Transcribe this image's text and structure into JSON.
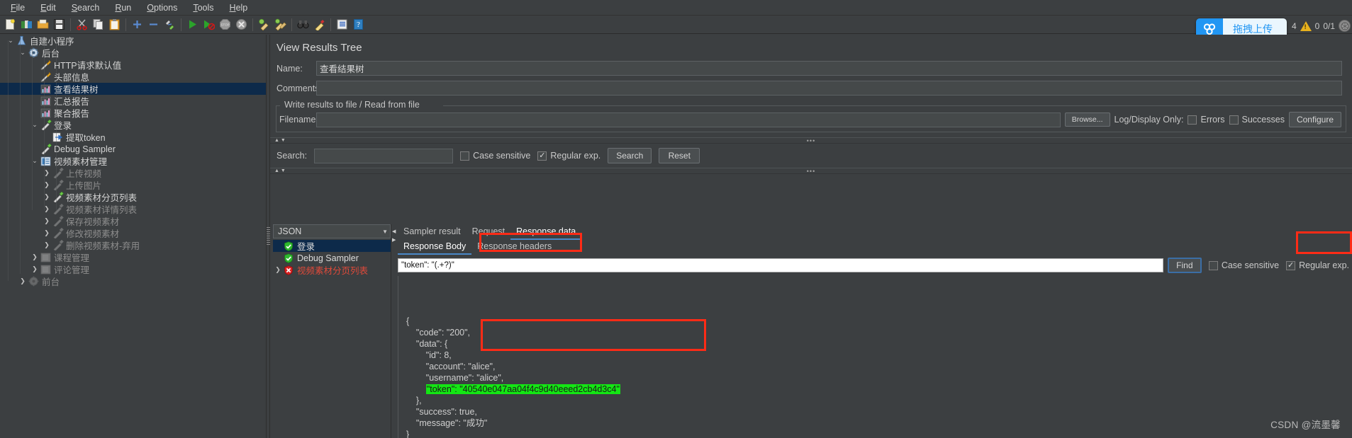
{
  "window": {
    "menubar": [
      {
        "label": "File",
        "mnemonic": "F"
      },
      {
        "label": "Edit",
        "mnemonic": "E"
      },
      {
        "label": "Search",
        "mnemonic": "S"
      },
      {
        "label": "Run",
        "mnemonic": "R"
      },
      {
        "label": "Options",
        "mnemonic": "O"
      },
      {
        "label": "Tools",
        "mnemonic": "T"
      },
      {
        "label": "Help",
        "mnemonic": "H"
      }
    ],
    "toolbar": [
      {
        "name": "new-icon"
      },
      {
        "name": "templates-icon"
      },
      {
        "name": "open-folder-icon"
      },
      {
        "name": "save-icon"
      },
      {
        "sep": true
      },
      {
        "name": "cut-scissors-icon"
      },
      {
        "name": "copy-icon"
      },
      {
        "name": "paste-clipboard-icon"
      },
      {
        "sep": true
      },
      {
        "name": "expand-plus-icon"
      },
      {
        "name": "collapse-minus-icon"
      },
      {
        "name": "toggle-pencil-icon"
      },
      {
        "sep": true
      },
      {
        "name": "start-play-icon"
      },
      {
        "name": "start-no-pauses-icon"
      },
      {
        "name": "stop-icon"
      },
      {
        "name": "shutdown-icon"
      },
      {
        "sep": true
      },
      {
        "name": "clear-broom-icon"
      },
      {
        "name": "clear-all-broom-icon"
      },
      {
        "sep": true
      },
      {
        "name": "search-binoculars-icon"
      },
      {
        "name": "search-reset-broom-icon"
      },
      {
        "sep": true
      },
      {
        "name": "function-helper-icon"
      },
      {
        "name": "help-question-icon"
      }
    ],
    "upload": {
      "icon": "baidu-netdisk-icon",
      "label": "拖拽上传"
    },
    "status": {
      "count": "4",
      "warn_icon": "warning-triangle-icon",
      "warn_count": "0",
      "threads": "0/1",
      "thread_icon": "thread-status-icon"
    }
  },
  "tree": {
    "selected_index": 3,
    "items": [
      {
        "depth": 0,
        "twisty": "v",
        "icon": "test-plan-icon",
        "label": "自建小程序",
        "state": "normal"
      },
      {
        "depth": 1,
        "twisty": "v",
        "icon": "thread-group-icon",
        "label": "后台",
        "state": "normal"
      },
      {
        "depth": 2,
        "twisty": "",
        "icon": "config-element-icon",
        "label": "HTTP请求默认值",
        "state": "normal"
      },
      {
        "depth": 2,
        "twisty": "",
        "icon": "config-element-icon",
        "label": "头部信息",
        "state": "normal"
      },
      {
        "depth": 2,
        "twisty": "",
        "icon": "listener-icon",
        "label": "查看结果树",
        "state": "selected"
      },
      {
        "depth": 2,
        "twisty": "",
        "icon": "listener-icon",
        "label": "汇总报告",
        "state": "normal"
      },
      {
        "depth": 2,
        "twisty": "",
        "icon": "listener-icon",
        "label": "聚合报告",
        "state": "normal"
      },
      {
        "depth": 2,
        "twisty": "v",
        "icon": "sampler-icon",
        "label": "登录",
        "state": "normal"
      },
      {
        "depth": 3,
        "twisty": "",
        "icon": "post-processor-icon",
        "label": "提取token",
        "state": "normal"
      },
      {
        "depth": 2,
        "twisty": "",
        "icon": "sampler-icon",
        "label": "Debug Sampler",
        "state": "normal"
      },
      {
        "depth": 2,
        "twisty": "v",
        "icon": "transaction-controller-icon",
        "label": "视频素材管理",
        "state": "normal"
      },
      {
        "depth": 3,
        "twisty": ">",
        "icon": "sampler-disabled-icon",
        "label": "上传视频",
        "state": "disabled"
      },
      {
        "depth": 3,
        "twisty": ">",
        "icon": "sampler-disabled-icon",
        "label": "上传图片",
        "state": "disabled"
      },
      {
        "depth": 3,
        "twisty": ">",
        "icon": "sampler-icon",
        "label": "视频素材分页列表",
        "state": "normal"
      },
      {
        "depth": 3,
        "twisty": ">",
        "icon": "sampler-disabled-icon",
        "label": "视频素材详情列表",
        "state": "disabled"
      },
      {
        "depth": 3,
        "twisty": ">",
        "icon": "sampler-disabled-icon",
        "label": "保存视频素材",
        "state": "disabled"
      },
      {
        "depth": 3,
        "twisty": ">",
        "icon": "sampler-disabled-icon",
        "label": "修改视频素材",
        "state": "disabled"
      },
      {
        "depth": 3,
        "twisty": ">",
        "icon": "sampler-disabled-icon",
        "label": "删除视频素材-弃用",
        "state": "disabled"
      },
      {
        "depth": 2,
        "twisty": ">",
        "icon": "controller-disabled-icon",
        "label": "课程管理",
        "state": "disabled"
      },
      {
        "depth": 2,
        "twisty": ">",
        "icon": "controller-disabled-icon",
        "label": "评论管理",
        "state": "disabled"
      },
      {
        "depth": 1,
        "twisty": ">",
        "icon": "thread-group-disabled-icon",
        "label": "前台",
        "state": "disabled"
      }
    ]
  },
  "panel": {
    "title": "View Results Tree",
    "name_label": "Name:",
    "name_value": "查看结果树",
    "comments_label": "Comments:",
    "comments_value": "",
    "comments_placeholder": "",
    "file_group_legend": "Write results to file / Read from file",
    "filename_label": "Filename",
    "filename_value": "",
    "browse_button": "Browse...",
    "log_display_label": "Log/Display Only:",
    "errors_checkbox": {
      "label": "Errors",
      "checked": false
    },
    "successes_checkbox": {
      "label": "Successes",
      "checked": false
    },
    "configure_button": "Configure"
  },
  "search_bar": {
    "label": "Search:",
    "value": "",
    "case_sensitive": {
      "label": "Case sensitive",
      "checked": false
    },
    "regular_exp": {
      "label": "Regular exp.",
      "checked": true
    },
    "search_button": "Search",
    "reset_button": "Reset"
  },
  "results": {
    "renderer_combo": "JSON",
    "renderer_options": [
      "JSON"
    ],
    "items": [
      {
        "label": "登录",
        "status": "success",
        "twisty": "",
        "icon": "success-shield-icon",
        "selected": true
      },
      {
        "label": "Debug Sampler",
        "status": "success",
        "twisty": "",
        "icon": "success-shield-icon",
        "selected": false
      },
      {
        "label": "视频素材分页列表",
        "status": "error",
        "twisty": ">",
        "icon": "error-shield-icon",
        "selected": false
      }
    ]
  },
  "detail": {
    "tabs": [
      {
        "label": "Sampler result",
        "active": false
      },
      {
        "label": "Request",
        "active": false
      },
      {
        "label": "Response data",
        "active": true
      }
    ],
    "subtabs": [
      {
        "label": "Response Body",
        "active": true
      },
      {
        "label": "Response headers",
        "active": false
      }
    ],
    "find": {
      "value": "\"token\": \"(.+?)\"",
      "button": "Find",
      "case_sensitive": {
        "label": "Case sensitive",
        "checked": false
      },
      "regular_exp": {
        "label": "Regular exp.",
        "checked": true
      }
    },
    "response_body": [
      {
        "text": "{",
        "indent": 0,
        "highlight": false
      },
      {
        "text": "\"code\": \"200\",",
        "indent": 1,
        "highlight": false
      },
      {
        "text": "\"data\": {",
        "indent": 1,
        "highlight": false
      },
      {
        "text": "\"id\": 8,",
        "indent": 2,
        "highlight": false
      },
      {
        "text": "\"account\": \"alice\",",
        "indent": 2,
        "highlight": false
      },
      {
        "text": "\"username\": \"alice\",",
        "indent": 2,
        "highlight": false
      },
      {
        "text": "\"token\": \"40540e047aa04f4c9d40eeed2cb4d3c4\"",
        "indent": 2,
        "highlight": true
      },
      {
        "text": "},",
        "indent": 1,
        "highlight": false
      },
      {
        "text": "\"success\": true,",
        "indent": 1,
        "highlight": false
      },
      {
        "text": "\"message\": \"成功\"",
        "indent": 1,
        "highlight": false
      },
      {
        "text": "}",
        "indent": 0,
        "highlight": false
      }
    ]
  },
  "annotations": {
    "highlight_color": "#ff2b16",
    "token_highlight_color": "#14e614"
  },
  "watermark": "CSDN @流墨馨"
}
